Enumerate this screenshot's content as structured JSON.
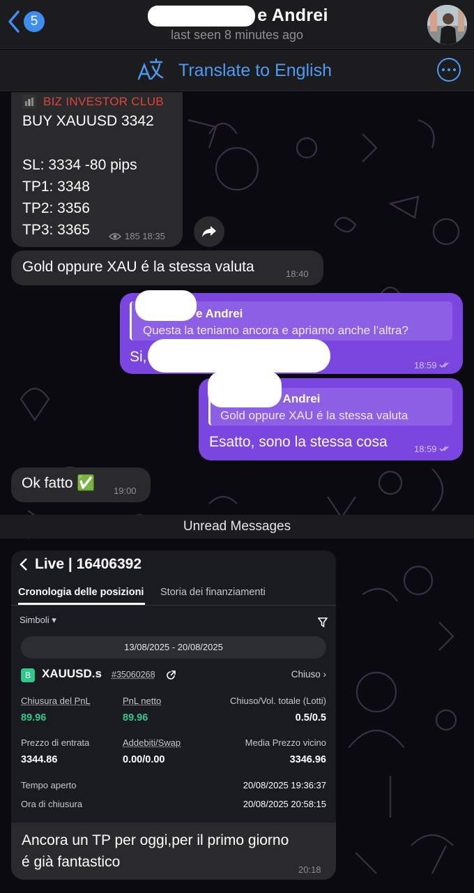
{
  "header": {
    "back_count": "5",
    "contact_name_visible": "e Andrei",
    "last_seen": "last seen 8 minutes ago"
  },
  "translate_bar": {
    "label": "Translate to English"
  },
  "post": {
    "channel": "BIZ INVESTOR CLUB",
    "lines": [
      "BUY XAUUSD 3342",
      "SL: 3334 -80 pips",
      "TP1: 3348",
      "TP2: 3356",
      "TP3: 3365"
    ],
    "views": "185",
    "time": "18:35"
  },
  "messages": {
    "gold": {
      "text": "Gold oppure XAU é la stessa valuta",
      "time": "18:40"
    },
    "reply1": {
      "quote_name": "e Andrei",
      "quote_text": "Questa la teniamo ancora e apriamo anche l’altra?",
      "text": "Si,",
      "time": "18:59"
    },
    "reply2": {
      "quote_name": "e Andrei",
      "quote_text": "Gold oppure XAU é la stessa valuta",
      "text": "Esatto, sono la stessa cosa",
      "time": "18:59"
    },
    "ok": {
      "text": "Ok fatto ✅",
      "time": "19:00"
    },
    "final": {
      "text_line1": "Ancora un TP per oggi,per il primo giorno",
      "text_line2": "é già fantastico",
      "time": "20:18"
    }
  },
  "divider": "Unread Messages",
  "screenshot": {
    "title": "Live | 16406392",
    "tab_active": "Cronologia delle posizioni",
    "tab_other": "Storia dei finanziamenti",
    "filter": "Simboli ▾",
    "date_range": "13/08/2025 - 20/08/2025",
    "badge": "B",
    "symbol": "XAUUSD.s",
    "position_id": "#35060268",
    "status": "Chiuso",
    "fields": {
      "close_pnl_label": "Chiusura del PnL",
      "close_pnl": "89.96",
      "net_pnl_label": "PnL netto",
      "net_pnl": "89.96",
      "volume_label": "Chiuso/Vol. totale (Lotti)",
      "volume": "0.5/0.5",
      "entry_label": "Prezzo di entrata",
      "entry": "3344.86",
      "swap_label": "Addebiti/Swap",
      "swap": "0.00/0.00",
      "avg_label": "Media Prezzo vicino",
      "avg": "3346.96",
      "open_time_label": "Tempo aperto",
      "open_time": "20/08/2025 19:36:37",
      "close_time_label": "Ora di chiusura",
      "close_time": "20/08/2025 20:58:15"
    }
  },
  "colors": {
    "accent": "#4b9cf5",
    "outgoing": "#7b45e0",
    "incoming": "#2a2a2c",
    "channel": "#e0453b",
    "profit": "#2ec98a"
  }
}
